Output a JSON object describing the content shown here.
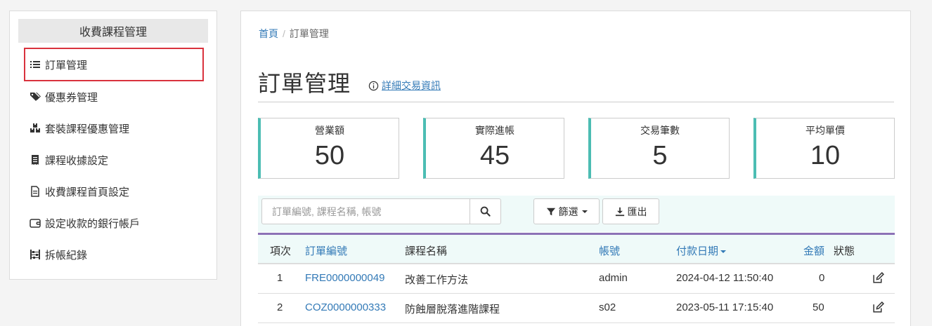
{
  "sidebar": {
    "title": "收費課程管理",
    "items": [
      {
        "label": "訂單管理",
        "icon": "list-icon"
      },
      {
        "label": "優惠券管理",
        "icon": "tags-icon"
      },
      {
        "label": "套裝課程優惠管理",
        "icon": "boxes-icon"
      },
      {
        "label": "課程收據設定",
        "icon": "receipt-icon"
      },
      {
        "label": "收費課程首頁設定",
        "icon": "file-icon"
      },
      {
        "label": "設定收款的銀行帳戶",
        "icon": "wallet-icon"
      },
      {
        "label": "拆帳紀錄",
        "icon": "abacus-icon"
      }
    ]
  },
  "breadcrumb": {
    "home": "首頁",
    "separator": "/",
    "current": "訂單管理"
  },
  "page": {
    "title": "訂單管理",
    "detail_link": "詳細交易資訊"
  },
  "stats": [
    {
      "label": "營業額",
      "value": "50"
    },
    {
      "label": "實際進帳",
      "value": "45"
    },
    {
      "label": "交易筆數",
      "value": "5"
    },
    {
      "label": "平均單價",
      "value": "10"
    }
  ],
  "toolbar": {
    "search_placeholder": "訂單編號, 課程名稱, 帳號",
    "filter_label": "篩選",
    "export_label": "匯出"
  },
  "table": {
    "headers": {
      "index": "項次",
      "order_no": "訂單編號",
      "course": "課程名稱",
      "account": "帳號",
      "paid_at": "付款日期",
      "amount": "金額",
      "status": "狀態"
    },
    "rows": [
      {
        "index": "1",
        "order_no": "FRE0000000049",
        "course": "改善工作方法",
        "account": "admin",
        "paid_at": "2024-04-12 11:50:40",
        "amount": "0"
      },
      {
        "index": "2",
        "order_no": "COZ0000000333",
        "course": "防蝕層脫落進階課程",
        "account": "s02",
        "paid_at": "2023-05-11 17:15:40",
        "amount": "50"
      }
    ]
  },
  "colors": {
    "accent": "#4cbdb3",
    "link": "#337ab7",
    "active_border": "#d9323d",
    "table_top": "#8c72b6"
  }
}
